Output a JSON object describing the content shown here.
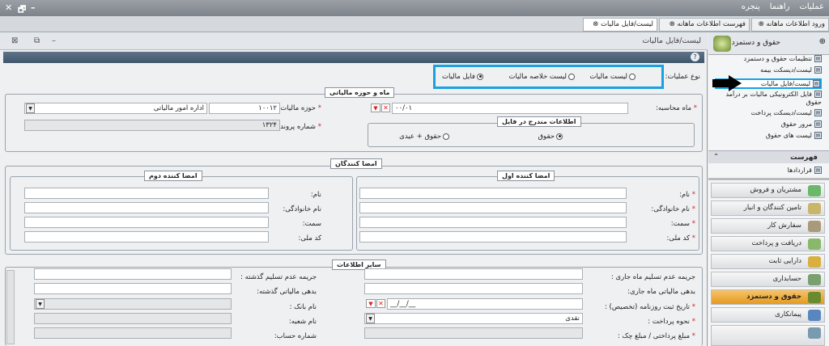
{
  "window": {
    "close": "✕",
    "restore": "🗗",
    "minimize": "–"
  },
  "menu": {
    "items": [
      "عملیات",
      "راهنما",
      "پنجره"
    ]
  },
  "doc_tabs": [
    "ورود اطلاعات ماهانه",
    "فهرست اطلاعات ماهانه",
    "لیست/فایل مالیات"
  ],
  "page": {
    "title": "لیست/فایل مالیات"
  },
  "op": {
    "label": "نوع عملیات:",
    "options": [
      "لیست مالیات",
      "لیست خلاصه مالیات",
      "فایل مالیات"
    ],
    "selected": "فایل مالیات"
  },
  "period_group": {
    "title": "ماه و حوزه مالیاتی",
    "month_label": "ماه محاسبه:",
    "month_value": "۰۰/۰۱",
    "zone_label": "حوزه مالیات:",
    "zone_code": "۱۰۰۱۲",
    "zone_name": "اداره امور مالیاتی",
    "case_label": "شماره پرونده:",
    "case_value": "۱۳۲۴"
  },
  "file_info": {
    "title": "اطلاعات مندرج در فایل",
    "options": [
      "حقوق",
      "حقوق + عیدی"
    ],
    "selected": "حقوق"
  },
  "signers": {
    "title": "امضا کنندگان",
    "first_title": "امضا کننده اول",
    "second_title": "امضا کننده دوم",
    "fields": [
      "نام:",
      "نام خانوادگی:",
      "سمت:",
      "کد ملی:"
    ]
  },
  "other": {
    "title": "سایر اطلاعات",
    "right_fields": [
      "جریمه عدم تسلیم ماه جاری :",
      "بدهی مالیاتی ماه جاری:",
      "تاریخ ثبت روزنامه (تخصیص) :",
      "نحوه پرداخت :",
      "مبلغ پرداختی / مبلغ چک :"
    ],
    "left_fields": [
      "جریمه عدم تسلیم گذشته :",
      "بدهی مالیاتی گذشته:",
      "نام بانک :",
      "نام شعبه:",
      "شماره حساب:"
    ],
    "date_value": "__/__/__",
    "payment_value": "نقدی"
  },
  "sidebar": {
    "title": "حقوق و دستمزد",
    "tree": [
      "تنظیمات حقوق و دستمزد",
      "لیست/دیسکت بیمه",
      "لیست/فایل مالیات",
      "فایل الکترونیکی مالیات بر درآمد حقوق",
      "لیست/دیسکت پرداخت",
      "مرور حقوق",
      "لیست های حقوق"
    ],
    "list_title": "فهرست",
    "list_items": [
      "قراردادها"
    ],
    "modules": [
      "مشتریان و فروش",
      "تامین کنندگان و انبار",
      "سفارش کار",
      "دریافت و پرداخت",
      "دارایی ثابت",
      "حسابداری",
      "حقوق و دستمزد",
      "پیمانکاری"
    ],
    "active_module": "حقوق و دستمزد"
  },
  "colors": {
    "highlight": "#1ba0e2",
    "active_module": "#f0b050",
    "required": "#d22"
  }
}
